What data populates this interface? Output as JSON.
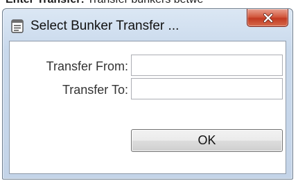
{
  "background_strip": {
    "bold_text": "Enter Transfer:",
    "rest_text": " Transfer bunkers betwe"
  },
  "dialog": {
    "title": "Select Bunker Transfer ...",
    "app_icon": "document-list-icon",
    "close_icon": "close-icon",
    "close_button_color": "#c94a30",
    "fields": {
      "from": {
        "label": "Transfer From:",
        "value": ""
      },
      "to": {
        "label": "Transfer To:",
        "value": ""
      }
    },
    "ok_label": "OK"
  }
}
